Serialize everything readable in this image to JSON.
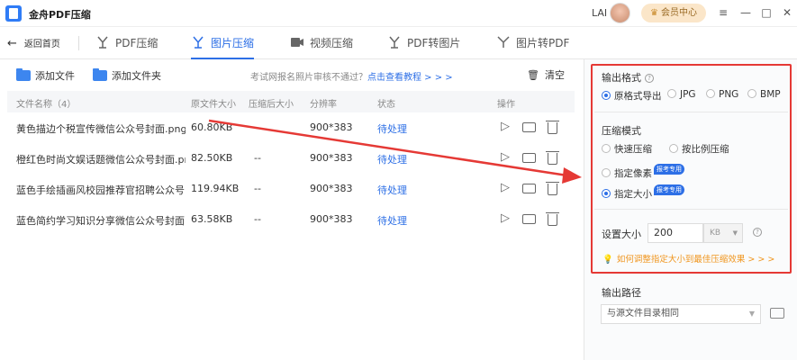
{
  "app": {
    "title": "金舟PDF压缩",
    "user_name": "LAI",
    "vip_label": "会员中心"
  },
  "window": {
    "menu": "≡",
    "minimize": "—",
    "maximize": "□",
    "close": "✕"
  },
  "nav": {
    "back_label": "返回首页",
    "tabs": [
      {
        "label": "PDF压缩",
        "icon": "pdf-compress-icon",
        "active": false
      },
      {
        "label": "图片压缩",
        "icon": "image-compress-icon",
        "active": true
      },
      {
        "label": "视频压缩",
        "icon": "video-compress-icon",
        "active": false
      },
      {
        "label": "PDF转图片",
        "icon": "pdf-to-image-icon",
        "active": false
      },
      {
        "label": "图片转PDF",
        "icon": "image-to-pdf-icon",
        "active": false
      }
    ]
  },
  "toolbar": {
    "add_file": "添加文件",
    "add_folder": "添加文件夹",
    "hint_text": "考试网报名照片审核不通过？",
    "hint_link": "点击查看教程 > > >",
    "clear": "清空"
  },
  "table": {
    "headers": [
      "文件名称（4）",
      "原文件大小",
      "压缩后大小",
      "分辨率",
      "状态",
      "操作"
    ],
    "rows": [
      {
        "name": "黄色描边个税宣传微信公众号封面.png",
        "size": "60.80KB",
        "compressed": "--",
        "resolution": "900*383",
        "status": "待处理"
      },
      {
        "name": "橙红色时尚文娱话题微信公众号封面.png",
        "size": "82.50KB",
        "compressed": "--",
        "resolution": "900*383",
        "status": "待处理"
      },
      {
        "name": "蓝色手绘插画风校园推荐官招聘公众号...",
        "size": "119.94KB",
        "compressed": "--",
        "resolution": "900*383",
        "status": "待处理"
      },
      {
        "name": "蓝色简约学习知识分享微信公众号封面.png",
        "size": "63.58KB",
        "compressed": "--",
        "resolution": "900*383",
        "status": "待处理"
      }
    ]
  },
  "settings": {
    "output_format_title": "输出格式",
    "formats": [
      "原格式导出",
      "JPG",
      "PNG",
      "BMP"
    ],
    "selected_format": "原格式导出",
    "mode_title": "压缩模式",
    "modes": [
      "快速压缩",
      "按比例压缩",
      "指定像素",
      "指定大小"
    ],
    "selected_mode": "指定大小",
    "exam_tag": "报考专用",
    "size_label": "设置大小",
    "size_value": "200",
    "size_unit": "KB",
    "size_hint": "如何调整指定大小到最佳压缩效果 > > >",
    "output_path_title": "输出路径",
    "output_path_value": "与源文件目录相同"
  },
  "colors": {
    "accent": "#2d6fe6",
    "annotation": "#e53935",
    "hint_orange": "#f0961f"
  }
}
